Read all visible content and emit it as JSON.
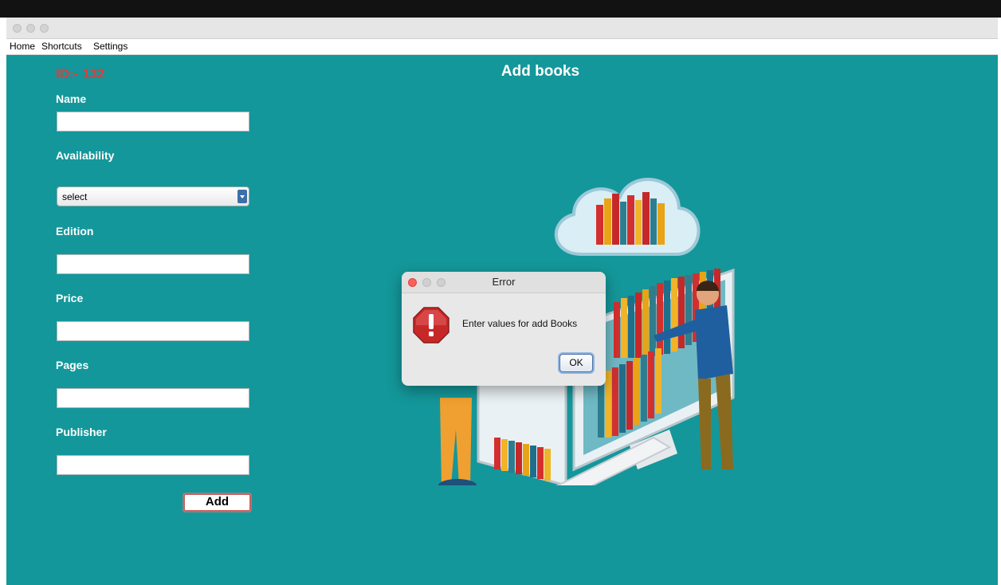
{
  "window": {
    "title": ""
  },
  "menu": {
    "items": [
      "Home",
      "Shortcuts",
      "Settings"
    ]
  },
  "form": {
    "id_label": "ID:- 132",
    "title": "Add books",
    "name_label": "Name",
    "name_value": "",
    "availability_label": "Availability",
    "availability_value": "select",
    "edition_label": "Edition",
    "edition_value": "",
    "price_label": "Price",
    "price_value": "",
    "pages_label": "Pages",
    "pages_value": "",
    "publisher_label": "Publisher",
    "publisher_value": "",
    "add_label": "Add"
  },
  "dialog": {
    "title": "Error",
    "message": "Enter values for add Books",
    "ok_label": "OK",
    "icon": "error-stop-icon"
  },
  "colors": {
    "background": "#14979a",
    "id_label": "#e23b3b",
    "error_icon": "#c62828"
  }
}
